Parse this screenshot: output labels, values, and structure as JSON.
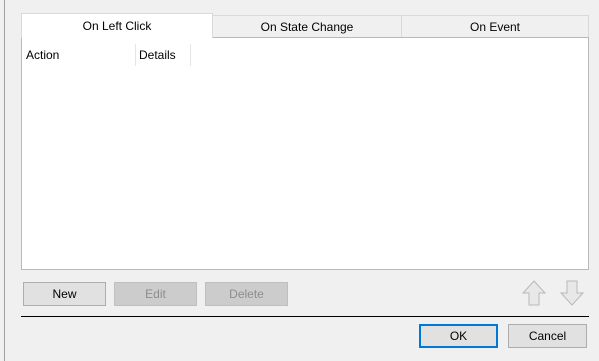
{
  "tabs": [
    {
      "label": "On Left Click",
      "active": true
    },
    {
      "label": "On State Change",
      "active": false
    },
    {
      "label": "On Event",
      "active": false
    }
  ],
  "table": {
    "columns": [
      "Action",
      "Details"
    ],
    "rows": []
  },
  "action_buttons": {
    "new_label": "New",
    "edit_label": "Edit",
    "delete_label": "Delete"
  },
  "dialog_buttons": {
    "ok_label": "OK",
    "cancel_label": "Cancel"
  },
  "icons": {
    "move_up": "arrow-up-icon",
    "move_down": "arrow-down-icon"
  },
  "colors": {
    "accent": "#0078d7",
    "disabled_text": "#8d8d8d"
  }
}
